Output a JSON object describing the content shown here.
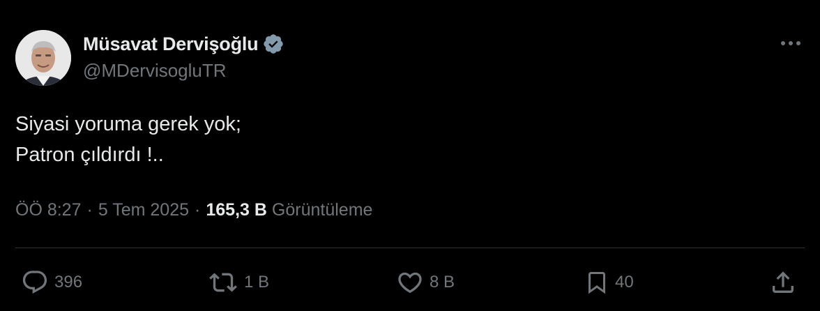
{
  "author": {
    "display_name": "Müsavat Dervişoğlu",
    "handle": "@MDervisogluTR",
    "verified": true
  },
  "tweet": {
    "lines": [
      "Siyasi yoruma gerek yok;",
      "Patron çıldırdı !.."
    ]
  },
  "meta": {
    "time": "ÖÖ 8:27",
    "separator": "·",
    "date": "5 Tem 2025",
    "views_count": "165,3 B",
    "views_label": "Görüntüleme"
  },
  "actions": {
    "replies": "396",
    "retweets": "1 B",
    "likes": "8 B",
    "bookmarks": "40"
  },
  "icons": {
    "more": "more-horizontal-icon",
    "verified": "verified-badge-icon",
    "reply": "reply-icon",
    "retweet": "retweet-icon",
    "like": "heart-icon",
    "bookmark": "bookmark-icon",
    "share": "share-icon"
  },
  "colors": {
    "background": "#000000",
    "primary_text": "#e7e9ea",
    "secondary_text": "#71767b",
    "divider": "#2f3336",
    "verified_badge": "#829aab"
  }
}
